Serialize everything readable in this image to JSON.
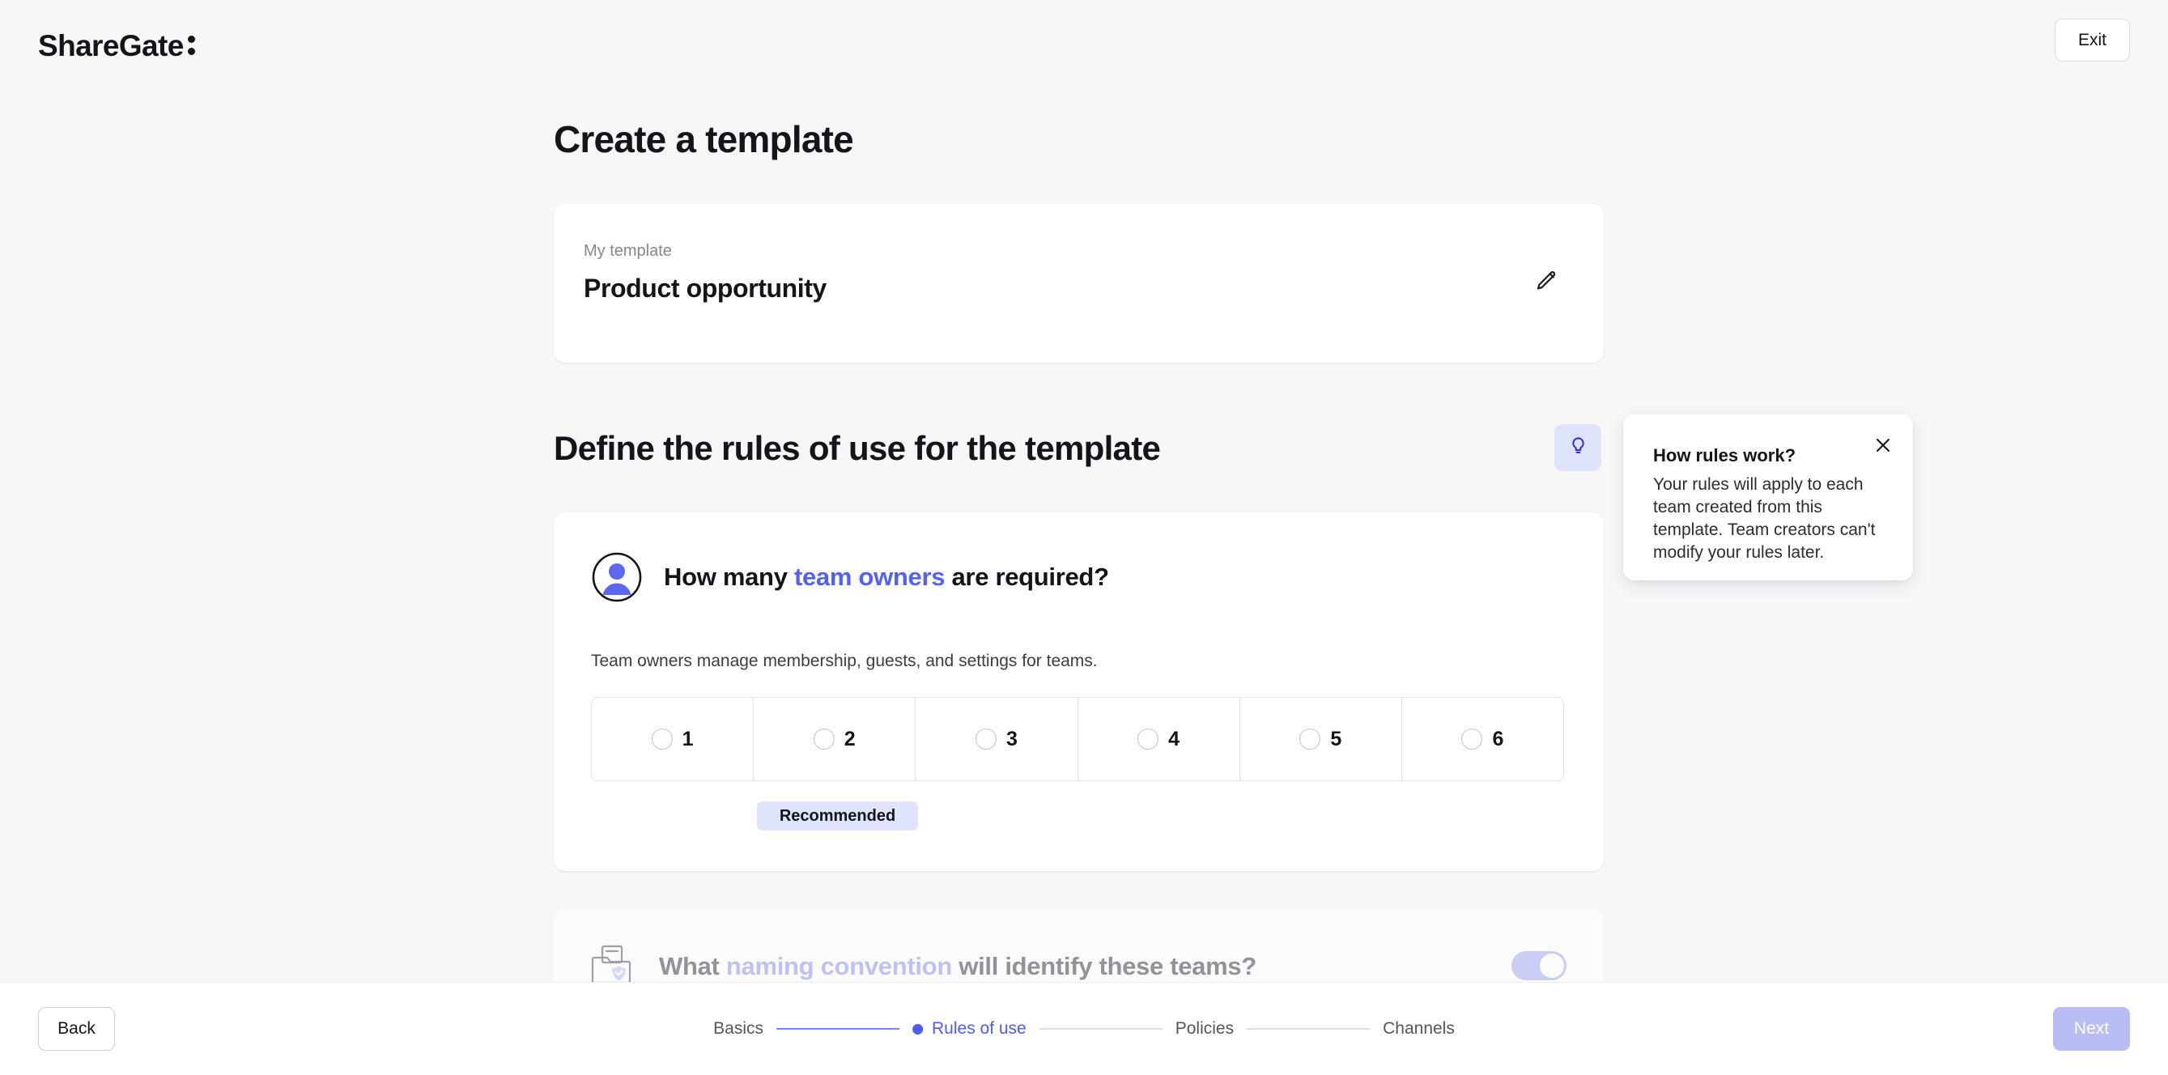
{
  "header": {
    "logo_text": "ShareGate",
    "logo_icon": "colon-dots-mark",
    "exit_label": "Exit"
  },
  "page": {
    "title": "Create a template"
  },
  "template_card": {
    "label": "My template",
    "name": "Product opportunity",
    "edit_icon": "pencil-icon"
  },
  "section": {
    "title": "Define the rules of use for the template",
    "help_icon": "lightbulb-icon"
  },
  "tooltip": {
    "title": "How rules work?",
    "body": "Your rules will apply to each team created from this template. Team creators can't modify your rules later.",
    "close_icon": "close-icon"
  },
  "owners_rule": {
    "icon": "person-avatar-icon",
    "question_prefix": "How many ",
    "question_highlight": "team owners",
    "question_suffix": " are required?",
    "description": "Team owners manage membership, guests, and settings for teams.",
    "options": [
      {
        "label": "1",
        "selected": false
      },
      {
        "label": "2",
        "selected": false
      },
      {
        "label": "3",
        "selected": false
      },
      {
        "label": "4",
        "selected": false
      },
      {
        "label": "5",
        "selected": false
      },
      {
        "label": "6",
        "selected": false
      }
    ],
    "recommended_badge": "Recommended",
    "recommended_for_option": "2"
  },
  "naming_rule": {
    "icon": "folder-check-icon",
    "question_prefix": "What ",
    "question_highlight": "naming convention",
    "question_suffix": " will identify these teams?",
    "toggle_on": true
  },
  "footer": {
    "back_label": "Back",
    "next_label": "Next",
    "steps": [
      {
        "label": "Basics",
        "state": "done"
      },
      {
        "label": "Rules of use",
        "state": "current"
      },
      {
        "label": "Policies",
        "state": "upcoming"
      },
      {
        "label": "Channels",
        "state": "upcoming"
      }
    ]
  },
  "colors": {
    "accent": "#4f5bf2",
    "accent_light": "#dfe3fb",
    "accent_muted": "#b9bdf3",
    "page_bg": "#f7f7f8",
    "card_bg": "#ffffff",
    "text": "#15141a",
    "text_muted": "#86868e"
  }
}
